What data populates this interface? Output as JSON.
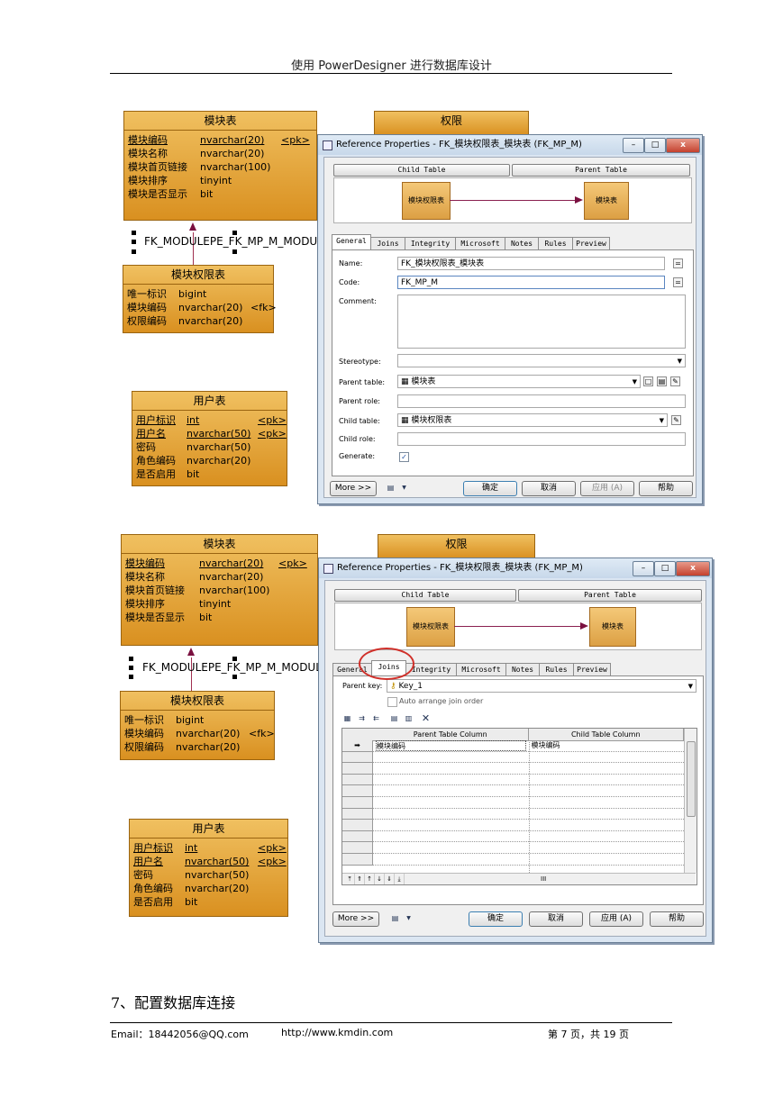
{
  "header": {
    "title": "使用 PowerDesigner 进行数据库设计"
  },
  "footer": {
    "email": "Email：18442056@QQ.com",
    "url": "http://www.kmdin.com",
    "page": "第 7 页，共 19 页"
  },
  "section_heading": "7、配置数据库连接",
  "diagram": {
    "module_table": {
      "title": "模块表",
      "rows": [
        {
          "name": "模块编码",
          "type": "nvarchar(20)",
          "key": "<pk>"
        },
        {
          "name": "模块名称",
          "type": "nvarchar(20)",
          "key": ""
        },
        {
          "name": "模块首页链接",
          "type": "nvarchar(100)",
          "key": ""
        },
        {
          "name": "模块排序",
          "type": "tinyint",
          "key": ""
        },
        {
          "name": "模块是否显示",
          "type": "bit",
          "key": ""
        }
      ]
    },
    "permission_table": {
      "title": "权限"
    },
    "reference_label": "FK_MODULEPE_FK_MP_M_MODUL",
    "module_perm_table": {
      "title": "模块权限表",
      "rows": [
        {
          "name": "唯一标识",
          "type": "bigint",
          "key": ""
        },
        {
          "name": "模块编码",
          "type": "nvarchar(20)",
          "key": "<fk>"
        },
        {
          "name": "权限编码",
          "type": "nvarchar(20)",
          "key": ""
        }
      ]
    },
    "user_table": {
      "title": "用户表",
      "rows": [
        {
          "name": "用户标识",
          "type": "int",
          "key": "<pk>"
        },
        {
          "name": "用户名",
          "type": "nvarchar(50)",
          "key": "<pk>"
        },
        {
          "name": "密码",
          "type": "nvarchar(50)",
          "key": ""
        },
        {
          "name": "角色编码",
          "type": "nvarchar(20)",
          "key": ""
        },
        {
          "name": "是否启用",
          "type": "bit",
          "key": ""
        }
      ]
    }
  },
  "dialog1": {
    "title": "Reference Properties - FK_模块权限表_模块表 (FK_MP_M)",
    "child_table_btn": "Child Table",
    "parent_table_btn": "Parent Table",
    "preview_child": "模块权限表",
    "preview_parent": "模块表",
    "tabs": [
      "General",
      "Joins",
      "Integrity",
      "Microsoft",
      "Notes",
      "Rules",
      "Preview"
    ],
    "labels": {
      "name": "Name:",
      "code": "Code:",
      "comment": "Comment:",
      "stereotype": "Stereotype:",
      "parent_table": "Parent table:",
      "parent_role": "Parent role:",
      "child_table": "Child table:",
      "child_role": "Child role:",
      "generate": "Generate:"
    },
    "values": {
      "name": "FK_模块权限表_模块表",
      "code": "FK_MP_M",
      "parent_table": "模块表",
      "child_table": "模块权限表"
    },
    "buttons": {
      "more": "More >>",
      "ok": "确定",
      "cancel": "取消",
      "apply": "应用 (A)",
      "help": "帮助"
    }
  },
  "dialog2": {
    "title": "Reference Properties - FK_模块权限表_模块表 (FK_MP_M)",
    "child_table_btn": "Child Table",
    "parent_table_btn": "Parent Table",
    "preview_child": "模块权限表",
    "preview_parent": "模块表",
    "tabs": [
      "General",
      "Joins",
      "Integrity",
      "Microsoft",
      "Notes",
      "Rules",
      "Preview"
    ],
    "parent_key_label": "Parent key:",
    "parent_key_value": "Key_1",
    "auto_arrange": "Auto arrange join order",
    "columns": [
      "Parent Table Column",
      "Child Table Column"
    ],
    "rows": [
      {
        "parent": "模块编码",
        "child": "模块编码"
      }
    ],
    "scroll_label": "III",
    "buttons": {
      "more": "More >>",
      "ok": "确定",
      "cancel": "取消",
      "apply": "应用 (A)",
      "help": "帮助"
    }
  },
  "colors": {
    "entity_fill": "#e0a030",
    "highlight_circle": "#d0302a",
    "dialog_frame": "#dbe6f2"
  }
}
